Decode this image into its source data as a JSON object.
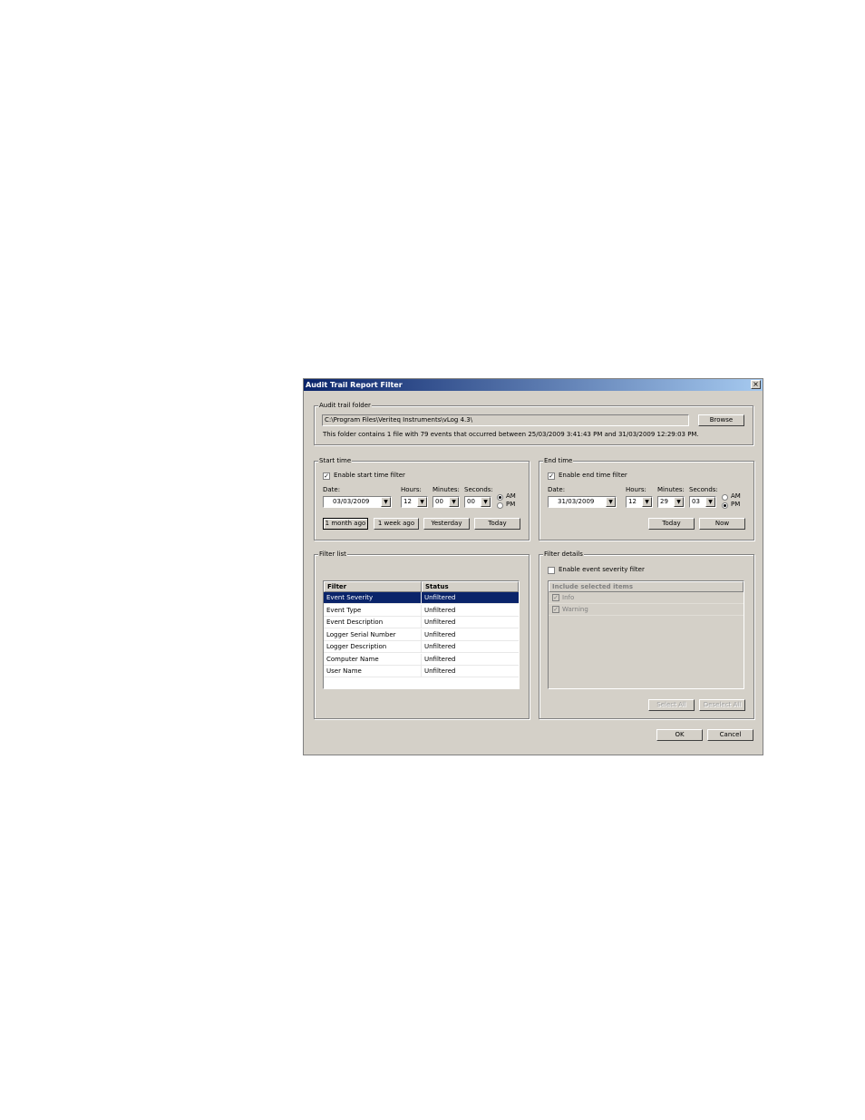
{
  "dialog": {
    "title": "Audit Trail Report Filter",
    "close": "×"
  },
  "folder": {
    "group_label": "Audit trail folder",
    "path": "C:\\Program Files\\Veriteq Instruments\\vLog 4.3\\",
    "browse_label": "Browse",
    "info": "This folder contains 1 file with 79 events that occurred between 25/03/2009 3:41:43 PM and 31/03/2009 12:29:03 PM."
  },
  "start_time": {
    "group_label": "Start time",
    "enable_label": "Enable start time filter",
    "enabled": true,
    "date_label": "Date:",
    "date": "03/03/2009",
    "hours_label": "Hours:",
    "hours": "12",
    "minutes_label": "Minutes:",
    "minutes": "00",
    "seconds_label": "Seconds:",
    "seconds": "00",
    "am_label": "AM",
    "pm_label": "PM",
    "meridiem": "AM",
    "buttons": [
      "1 month ago",
      "1 week ago",
      "Yesterday",
      "Today"
    ]
  },
  "end_time": {
    "group_label": "End time",
    "enable_label": "Enable end time filter",
    "enabled": true,
    "date_label": "Date:",
    "date": "31/03/2009",
    "hours_label": "Hours:",
    "hours": "12",
    "minutes_label": "Minutes:",
    "minutes": "29",
    "seconds_label": "Seconds:",
    "seconds": "03",
    "am_label": "AM",
    "pm_label": "PM",
    "meridiem": "PM",
    "buttons": [
      "Today",
      "Now"
    ]
  },
  "filter_list": {
    "group_label": "Filter list",
    "columns": [
      "Filter",
      "Status"
    ],
    "rows": [
      {
        "filter": "Event Severity",
        "status": "Unfiltered",
        "selected": true
      },
      {
        "filter": "Event Type",
        "status": "Unfiltered"
      },
      {
        "filter": "Event Description",
        "status": "Unfiltered"
      },
      {
        "filter": "Logger Serial Number",
        "status": "Unfiltered"
      },
      {
        "filter": "Logger Description",
        "status": "Unfiltered"
      },
      {
        "filter": "Computer Name",
        "status": "Unfiltered"
      },
      {
        "filter": "User Name",
        "status": "Unfiltered"
      }
    ]
  },
  "filter_details": {
    "group_label": "Filter details",
    "enable_label": "Enable event severity filter",
    "enabled": false,
    "list_header": "Include selected items",
    "items": [
      "Info",
      "Warning"
    ],
    "select_all_label": "Select All",
    "deselect_all_label": "Deselect All"
  },
  "footer": {
    "ok_label": "OK",
    "cancel_label": "Cancel"
  },
  "colors": {
    "dialog_bg": "#d4d0c8",
    "titlebar_start": "#0a246a",
    "titlebar_end": "#a6caf0",
    "selection": "#0a246a"
  }
}
